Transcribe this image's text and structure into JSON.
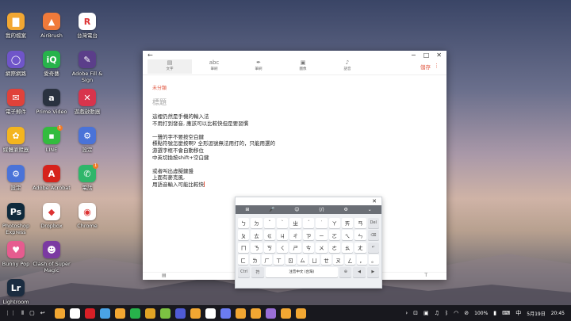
{
  "desktop": {
    "icons": [
      {
        "label": "我的檔案",
        "icon": "folder-icon",
        "color": "#f2a732",
        "glyph": "▇"
      },
      {
        "label": "AirBrush",
        "icon": "airbrush-icon",
        "color": "#f07a3a",
        "glyph": "▲"
      },
      {
        "label": "台灣電台",
        "icon": "radio-icon",
        "color": "#ffffff",
        "glyph": "R"
      },
      {
        "label": "網際網路",
        "icon": "internet-icon",
        "color": "#6f55c9",
        "glyph": "◯"
      },
      {
        "label": "愛奇藝",
        "icon": "iqiyi-icon",
        "color": "#27b34b",
        "glyph": "iQ"
      },
      {
        "label": "Adobe Fill &\nSign",
        "icon": "adobe-fill-sign-icon",
        "color": "#5b3e8a",
        "glyph": "✎"
      },
      {
        "label": "電子郵件",
        "icon": "email-icon",
        "color": "#e0423a",
        "glyph": "✉"
      },
      {
        "label": "Prime Video",
        "icon": "prime-video-icon",
        "color": "#2a3240",
        "glyph": "a"
      },
      {
        "label": "遊戲啟動器",
        "icon": "game-launcher-icon",
        "color": "#d8344c",
        "glyph": "✕"
      },
      {
        "label": "媒體瀏覽器",
        "icon": "media-browser-icon",
        "color": "#f4b51f",
        "glyph": "✿"
      },
      {
        "label": "LINE",
        "icon": "line-icon",
        "color": "#33bc3e",
        "glyph": "▪",
        "badge": "1"
      },
      {
        "label": "設定",
        "icon": "settings-icon",
        "color": "#4a73d8",
        "glyph": "⚙"
      },
      {
        "label": "設定",
        "icon": "settings-icon-2",
        "color": "#4a73d8",
        "glyph": "⚙"
      },
      {
        "label": "Adobe Acrobat",
        "icon": "adobe-acrobat-icon",
        "color": "#d6231c",
        "glyph": "A"
      },
      {
        "label": "電話",
        "icon": "phone-icon",
        "color": "#2fb66a",
        "glyph": "✆",
        "badge": "1"
      },
      {
        "label": "Photoshop\nExpress",
        "icon": "photoshop-express-icon",
        "color": "#0f2a3c",
        "glyph": "Ps"
      },
      {
        "label": "Dropbox",
        "icon": "dropbox-icon",
        "color": "#ffffff",
        "glyph": "◆"
      },
      {
        "label": "Chrome",
        "icon": "chrome-icon",
        "color": "#ffffff",
        "glyph": "◉"
      },
      {
        "label": "Bunny Pop",
        "icon": "bunny-pop-icon",
        "color": "#e65c8f",
        "glyph": "♥"
      },
      {
        "label": "Clash of Super\nMagic",
        "icon": "clash-magic-icon",
        "color": "#7b3aa2",
        "glyph": "☻"
      },
      {
        "label": "",
        "icon": "",
        "color": "transparent",
        "glyph": ""
      },
      {
        "label": "Lightroom",
        "icon": "lightroom-icon",
        "color": "#1b2c40",
        "glyph": "Lr"
      }
    ]
  },
  "notes": {
    "toolbar": [
      {
        "label": "文字",
        "icon": "text-icon",
        "glyph": "▤",
        "active": true
      },
      {
        "label": "筆刷",
        "icon": "brush-icon",
        "glyph": "abc",
        "active": false
      },
      {
        "label": "筆刷",
        "icon": "pen-icon",
        "glyph": "✒",
        "active": false
      },
      {
        "label": "圖像",
        "icon": "image-icon",
        "glyph": "▣",
        "active": false
      },
      {
        "label": "語音",
        "icon": "mic-icon",
        "glyph": "♪",
        "active": false
      }
    ],
    "save_label": "儲存",
    "category": "未分類",
    "title_placeholder": "標題",
    "lines": [
      "這裡仍然是手機的輸入法",
      "不用打到發音, 應該可以比較快但是要習慣",
      "",
      "一聲的字不要按空白鍵",
      "標點符號怎麼按啊? 全形逗號無法用打的，只能用選的",
      "游選字框不會自動移位",
      "中英切換按shift+空白鍵",
      "",
      "或者叫出虛擬鍵盤",
      "上面有麥克風,",
      "用語音輸入可能比較快"
    ]
  },
  "keyboard": {
    "toolbar": [
      "⊞",
      "🎤",
      "☺",
      "⟨/⟩",
      "⚙",
      "⌄"
    ],
    "rows": [
      [
        "ㄅ",
        "ㄉ",
        "ˇ",
        "ˋ",
        "ㄓ",
        "ˊ",
        "˙",
        "ㄚ",
        "ㄞ",
        "ㄢ",
        "Del"
      ],
      [
        "ㄆ",
        "ㄊ",
        "ㄍ",
        "ㄐ",
        "ㄔ",
        "ㄗ",
        "ㄧ",
        "ㄛ",
        "ㄟ",
        "ㄣ",
        "⌫"
      ],
      [
        "ㄇ",
        "ㄋ",
        "ㄎ",
        "ㄑ",
        "ㄕ",
        "ㄘ",
        "ㄨ",
        "ㄜ",
        "ㄠ",
        "ㄤ",
        "↵"
      ],
      [
        "ㄈ",
        "ㄌ",
        "ㄏ",
        "ㄒ",
        "ㄖ",
        "ㄙ",
        "ㄩ",
        "ㄝ",
        "ㄡ",
        "ㄥ",
        "，",
        "。"
      ],
      [
        "Ctrl",
        "符",
        "注音中文 (台灣)",
        "⊕",
        "◀",
        "▶"
      ]
    ]
  },
  "taskbar": {
    "apps": [
      {
        "icon": "folder-icon",
        "color": "#f2a732"
      },
      {
        "icon": "play-store-icon",
        "color": "#ffffff"
      },
      {
        "icon": "netflix-icon",
        "color": "#d81f26"
      },
      {
        "icon": "bixby-icon",
        "color": "#4aa3e6"
      },
      {
        "icon": "gallery-icon",
        "color": "#f2a732"
      },
      {
        "icon": "iqiyi-icon",
        "color": "#27b34b"
      },
      {
        "icon": "app-icon",
        "color": "#e1a525"
      },
      {
        "icon": "game-icon",
        "color": "#7cc242"
      },
      {
        "icon": "app-2-icon",
        "color": "#4f5bd5"
      },
      {
        "icon": "clock-icon",
        "color": "#f2a732"
      },
      {
        "icon": "calendar-icon",
        "color": "#ffffff"
      },
      {
        "icon": "camera-icon",
        "color": "#6b7cf2"
      },
      {
        "icon": "notes-icon",
        "color": "#f2a732"
      },
      {
        "icon": "notes-2-icon",
        "color": "#f2a732"
      },
      {
        "icon": "app-3-icon",
        "color": "#9a6fd8"
      },
      {
        "icon": "reminder-icon",
        "color": "#f2a732"
      },
      {
        "icon": "folder-2-icon",
        "color": "#f2a732"
      }
    ],
    "tray": {
      "battery": "100%",
      "date": "5月19日",
      "time": "20:45"
    }
  }
}
